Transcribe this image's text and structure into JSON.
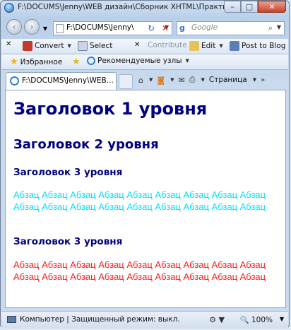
{
  "window": {
    "title": "F:\\DOCUMS\\Jenny\\WEB дизайн\\Сборник XHTML\\Практическ...",
    "buttons": {
      "minimize": "–",
      "maximize": "□",
      "close": "✕"
    }
  },
  "navigation": {
    "back_icon": "‹",
    "forward_icon": "›",
    "address": "F:\\DOCUMS\\Jenny\\",
    "search_placeholder": "Google"
  },
  "command_bar": {
    "convert": "Convert",
    "select": "Select",
    "contribute": "Contribute",
    "edit": "Edit",
    "post_to_blog": "Post to Blog"
  },
  "favorites_bar": {
    "favorites": "Избранное",
    "suggested_sites": "Рекомендуемые узлы"
  },
  "tabs": [
    {
      "label": "F:\\DOCUMS\\Jenny\\WEB..."
    }
  ],
  "tab_tools": {
    "page": "Страница"
  },
  "page": {
    "h1": "Заголовок 1 уровня",
    "h2": "Заголовок 2 уровня",
    "h3_first": "Заголовок 3 уровня",
    "paragraph_cyan": "Абзац Абзац Абзац Абзац Абзац Абзац Абзац Абзац Абзац Абзац Абзац Абзац Абзац Абзац Абзац Абзац Абзац Абзац",
    "h3_second": "Заголовок 3 уровня",
    "paragraph_red": "Абзац Абзац Абзац Абзац Абзац Абзац Абзац Абзац Абзац Абзац Абзац Абзац Абзац Абзац Абзац Абзац Абзац Абзац",
    "colors": {
      "heading": "#000080",
      "paragraph_cyan": "#00e0ff",
      "paragraph_red": "#ff1a1a"
    }
  },
  "status_bar": {
    "zone": "Компьютер | Защищенный режим: выкл.",
    "zoom": "100%"
  }
}
